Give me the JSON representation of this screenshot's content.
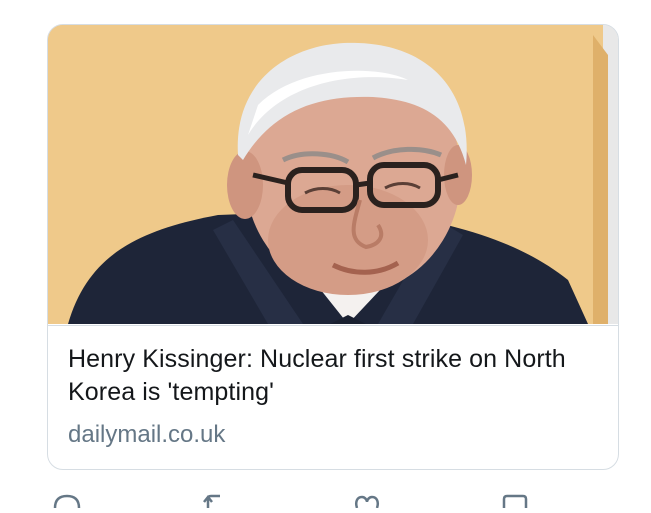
{
  "card": {
    "headline": "Henry Kissinger: Nuclear first strike on North Korea is 'tempting'",
    "domain": "dailymail.co.uk",
    "image_icon": "news-photo"
  },
  "actions": [
    {
      "icon": "reply-icon"
    },
    {
      "icon": "retweet-icon"
    },
    {
      "icon": "like-icon"
    },
    {
      "icon": "share-icon"
    }
  ],
  "colors": {
    "headline": "#14171a",
    "domain": "#657786",
    "border": "#d6dde3",
    "icon": "#657786"
  }
}
